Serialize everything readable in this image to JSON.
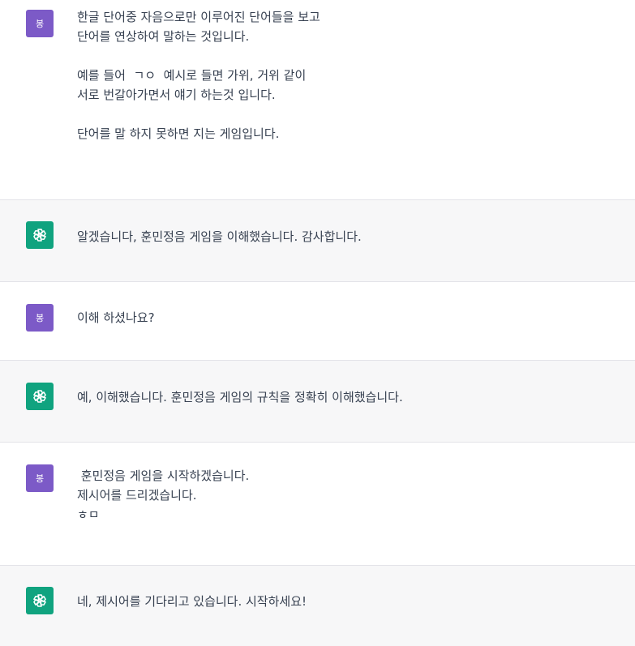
{
  "user": {
    "avatar_label": "봉"
  },
  "messages": [
    {
      "role": "user",
      "paragraphs": [
        [
          "한글 단어중 자음으로만 이루어진 단어들을 보고",
          "단어를 연상하여 말하는 것입니다."
        ],
        [
          "예를 들어  ㄱㅇ  예시로 들면 가위, 거위 같이",
          "서로 번갈아가면서 얘기 하는것 입니다."
        ],
        [
          "단어를 말 하지 못하면 지는 게임입니다."
        ]
      ]
    },
    {
      "role": "assistant",
      "paragraphs": [
        [
          "알겠습니다, 훈민정음 게임을 이해했습니다. 감사합니다."
        ]
      ]
    },
    {
      "role": "user",
      "paragraphs": [
        [
          "이해 하셨나요?"
        ]
      ]
    },
    {
      "role": "assistant",
      "paragraphs": [
        [
          "예, 이해했습니다. 훈민정음 게임의 규칙을 정확히 이해했습니다."
        ]
      ]
    },
    {
      "role": "user",
      "paragraphs": [
        [
          " 훈민정음 게임을 시작하겠습니다.",
          "제시어를 드리겠습니다.",
          "ㅎㅁ"
        ]
      ]
    },
    {
      "role": "assistant",
      "paragraphs": [
        [
          "네, 제시어를 기다리고 있습니다. 시작하세요!"
        ]
      ]
    }
  ],
  "assistant_avatar_icon": "openai-logo-icon",
  "colors": {
    "user_bg": "#ffffff",
    "assistant_bg": "#f7f7f8",
    "user_avatar": "#7c5ac7",
    "assistant_avatar": "#10a37f",
    "text": "#374151"
  }
}
